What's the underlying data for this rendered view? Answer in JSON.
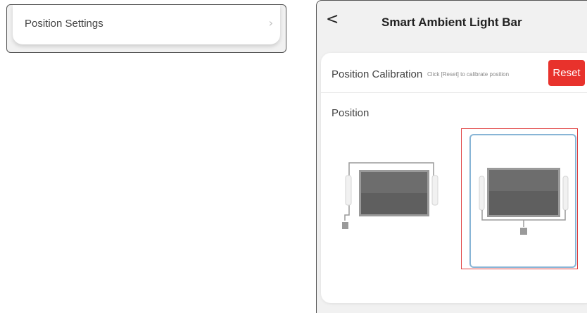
{
  "settings_list": {
    "position_settings_label": "Position Settings",
    "chevron_icon": "chevron-right-icon"
  },
  "header": {
    "back_icon": "back-arrow-icon",
    "title": "Smart Ambient Light Bar"
  },
  "calibration": {
    "title": "Position Calibration",
    "hint": "Click [Reset] to calibrate position",
    "reset_label": "Reset"
  },
  "position": {
    "label": "Position",
    "options": [
      {
        "name": "Behind the TV, bars on both sides",
        "selected": false
      },
      {
        "name": "Mounted with bars on both sides",
        "selected": true
      }
    ]
  },
  "colors": {
    "reset_button": "#e8322c",
    "selected_border": "#88b5d6",
    "highlight_outline": "#e04040"
  }
}
